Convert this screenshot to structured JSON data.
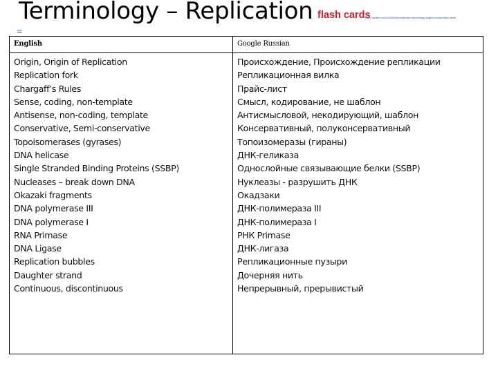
{
  "slide": {
    "title": "Terminology – Replication",
    "flash_cards_label": "flash cards",
    "source_link_text": "https://quizlet.com/142093/dna-replication-terminology-english-russian-flash-cards/",
    "source_link_continuation": "ods"
  },
  "table": {
    "headers": {
      "english": "English",
      "russian": "Google Russian"
    },
    "rows": [
      {
        "english": "Origin, Origin of Replication",
        "russian": "Происхождение, Происхождение репликации"
      },
      {
        "english": "Replication fork",
        "russian": "Репликационная вилка"
      },
      {
        "english": "Chargaff’s Rules",
        "russian": "Прайс-лист"
      },
      {
        "english": "Sense, coding, non-template",
        "russian": "Смысл, кодирование, не шаблон"
      },
      {
        "english": "Antisense, non-coding, template",
        "russian": "Антисмысловой, некодирующий, шаблон"
      },
      {
        "english": "Conservative, Semi-conservative",
        "russian": "Консервативный, полуконсервативный"
      },
      {
        "english": "Topoisomerases (gyrases)",
        "russian": "Топоизомеразы (гираны)"
      },
      {
        "english": "DNA helicase",
        "russian": "ДНК-геликаза"
      },
      {
        "english": "Single Stranded Binding Proteins (SSBP)",
        "russian": "Однослойные связывающие белки (SSBP)"
      },
      {
        "english": "Nucleases – break down DNA",
        "russian": "Нуклеазы - разрушить ДНК"
      },
      {
        "english": "Okazaki fragments",
        "russian": "Окадзаки"
      },
      {
        "english": "DNA polymerase III",
        "russian": "ДНК-полимераза III"
      },
      {
        "english": "DNA polymerase I",
        "russian": "ДНК-полимераза I"
      },
      {
        "english": "RNA Primase",
        "russian": "РНК Primase"
      },
      {
        "english": "DNA Ligase",
        "russian": "ДНК-лигаза"
      },
      {
        "english": "Replication bubbles",
        "russian": "Репликационные пузыри"
      },
      {
        "english": "Daughter strand",
        "russian": "Дочерняя нить"
      },
      {
        "english": "Continuous, discontinuous",
        "russian": "Непрерывный, прерывистый"
      }
    ]
  },
  "colors": {
    "title": "#000000",
    "flash_cards": "#d2202b",
    "link": "#1d4fa6",
    "table_border": "#000000"
  }
}
